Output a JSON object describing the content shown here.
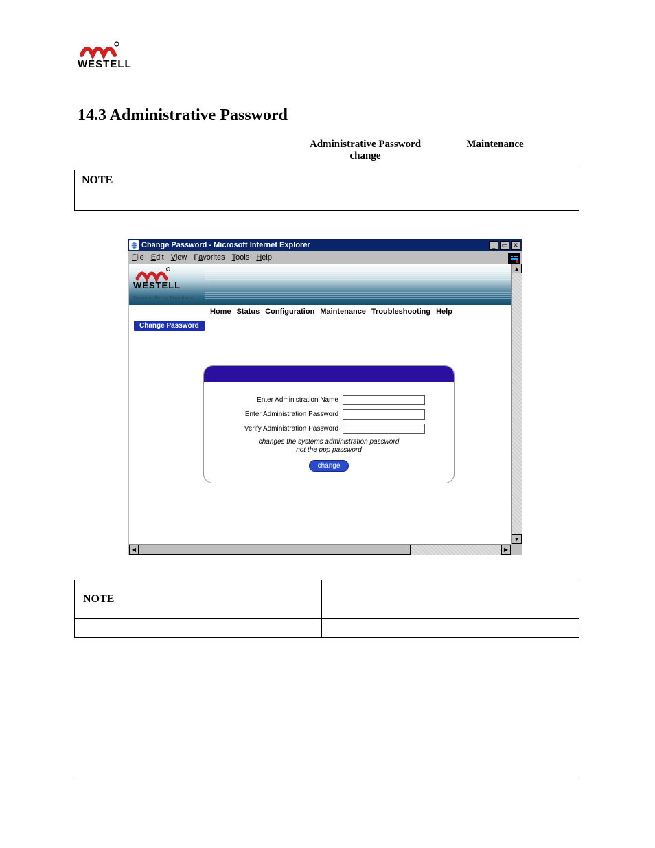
{
  "page": {
    "logo_brand": "WESTELL",
    "section_heading": "14.3 Administrative Password",
    "sub_heading_a": "Administrative Password change",
    "sub_heading_b": "Maintenance",
    "note1_label": "NOTE"
  },
  "ie": {
    "title": "Change Password - Microsoft Internet Explorer",
    "menus": {
      "file": "File",
      "edit": "Edit",
      "view": "View",
      "favorites": "Favorites",
      "tools": "Tools",
      "help": "Help"
    }
  },
  "router": {
    "brand": "WESTELL",
    "tagline": "Discover Better Broadband",
    "nav": {
      "home": "Home",
      "status": "Status",
      "configuration": "Configuration",
      "maintenance": "Maintenance",
      "troubleshooting": "Troubleshooting",
      "help": "Help"
    },
    "sidebar": {
      "change_password": "Change Password"
    },
    "form": {
      "admin_name_label": "Enter Administration Name",
      "admin_pwd_label": "Enter Administration Password",
      "verify_pwd_label": "Verify Administration Password",
      "hint_line1": "changes the systems administration password",
      "hint_line2": "not the ppp password",
      "change_button": "change"
    }
  },
  "table": {
    "note_label": "NOTE"
  }
}
